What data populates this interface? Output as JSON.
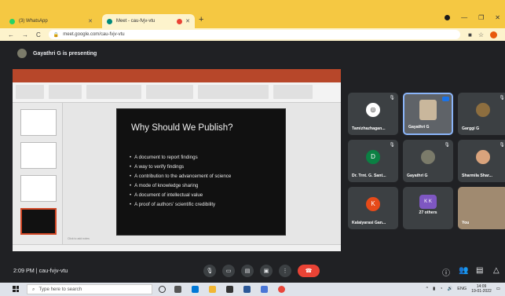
{
  "browser": {
    "tabs": [
      {
        "label": "(3) WhatsApp",
        "favicon_color": "#25d366"
      },
      {
        "label": "Meet - cau-fvjv-vtu",
        "favicon_color": "#00897b"
      }
    ],
    "new_tab_icon": "plus-icon",
    "url": "meet.google.com/cau-fvjv-vtu"
  },
  "meet": {
    "presenting_banner": "Gayathri G is presenting",
    "slide": {
      "title": "Why Should We Publish?",
      "bullets": [
        "A document to report findings",
        "A way to verify findings",
        "A contribution to the advancement of science",
        "A mode of knowledge sharing",
        "A document of intellectual value",
        "A proof of authors' scientific credibility"
      ],
      "notes_placeholder": "Click to add notes"
    },
    "participants": [
      {
        "name": "Tamizhazhagan...",
        "initial": "",
        "avatar_color": "#ffffff"
      },
      {
        "name": "Gayathri G",
        "initial": "",
        "avatar_color": "#c9b79c"
      },
      {
        "name": "Garggi G",
        "initial": "",
        "avatar_color": "#8d6e3f"
      },
      {
        "name": "Dr. Trnt. G. Sant...",
        "initial": "D",
        "avatar_color": "#0b8043"
      },
      {
        "name": "Gayathri G",
        "initial": "",
        "avatar_color": "#7b7b6a"
      },
      {
        "name": "Sharmila Shar...",
        "initial": "",
        "avatar_color": "#d9a37c"
      },
      {
        "name": "Kalaiyarasi Gan...",
        "initial": "K",
        "avatar_color": "#e64a19"
      },
      {
        "name": "27 others",
        "initial": "K K",
        "avatar_color": "#7e57c2"
      },
      {
        "name": "You",
        "initial": "",
        "avatar_color": "#a08a70"
      }
    ],
    "bottom_left": {
      "time": "2:09 PM",
      "meeting_code": "cau-fvjv-vtu"
    },
    "accent_red": "#ea4335",
    "accent_blue": "#8ab4f8"
  },
  "taskbar": {
    "search_placeholder": "Type here to search",
    "language": "ENG",
    "clock_time": "14:09",
    "clock_date": "19-01-2022"
  }
}
